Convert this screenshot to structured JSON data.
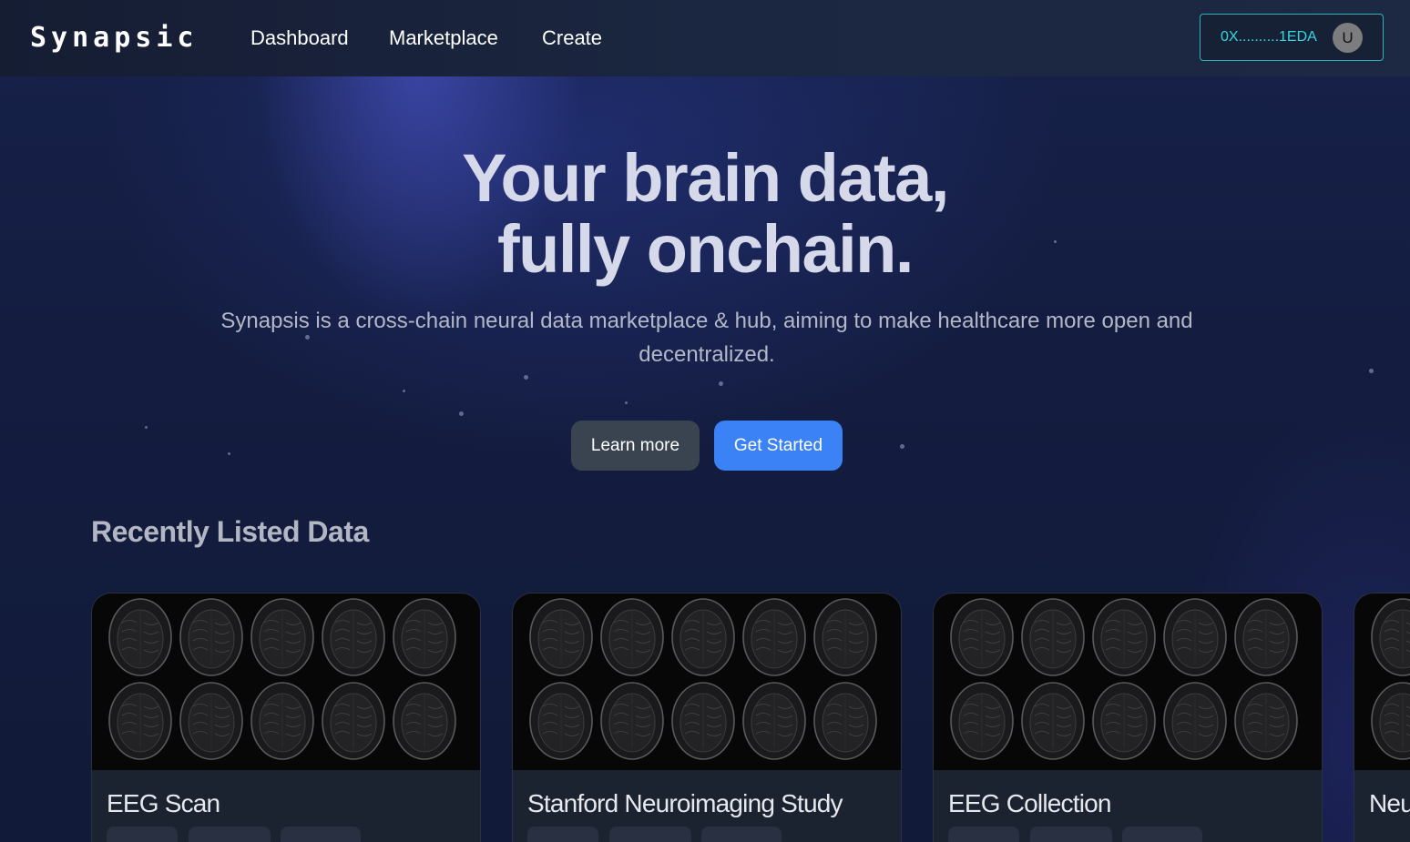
{
  "nav": {
    "logo": "Synapsic",
    "links": [
      "Dashboard",
      "Marketplace",
      "Create"
    ],
    "wallet_address": "0X..........1EDA",
    "avatar_initial": "U"
  },
  "hero": {
    "title_line1": "Your brain data,",
    "title_line2": "fully onchain.",
    "subtitle": "Synapsis is a cross-chain neural data marketplace & hub, aiming to make healthcare more open and decentralized.",
    "learn_more_label": "Learn more",
    "get_started_label": "Get Started"
  },
  "recent": {
    "title": "Recently Listed Data",
    "cards": [
      {
        "title": "EEG Scan"
      },
      {
        "title": "Stanford Neuroimaging Study"
      },
      {
        "title": "EEG Collection"
      },
      {
        "title": "Neu"
      }
    ]
  },
  "colors": {
    "accent": "#3b82f6",
    "wallet_border": "#2bb3b8",
    "wallet_text": "#31d8de",
    "background": "#111a35"
  },
  "icons": {
    "avatar": "user-avatar-circle"
  }
}
